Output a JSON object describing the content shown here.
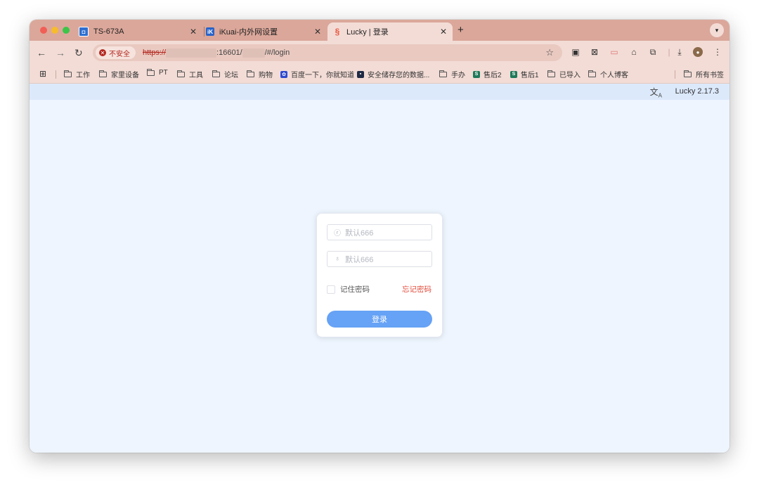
{
  "browser": {
    "tabs": [
      {
        "label": "TS-673A",
        "icon": "qnap-icon"
      },
      {
        "label": "iKuai-内外网设置",
        "icon": "ikuai-icon"
      },
      {
        "label": "Lucky | 登录",
        "icon": "lucky-icon",
        "active": true
      }
    ],
    "new_tab": "+",
    "address": {
      "security_label": "不安全",
      "scheme": "https://",
      "port_part": ":16601/",
      "path_part": "/#/login"
    },
    "bookmarks": [
      {
        "label": "工作",
        "type": "folder"
      },
      {
        "label": "家里设备",
        "type": "folder"
      },
      {
        "label": "PT",
        "type": "folder"
      },
      {
        "label": "工具",
        "type": "folder"
      },
      {
        "label": "论坛",
        "type": "folder"
      },
      {
        "label": "购物",
        "type": "folder"
      },
      {
        "label": "百度一下，你就知道",
        "type": "link"
      },
      {
        "label": "安全储存您的数据...",
        "type": "link"
      },
      {
        "label": "手办",
        "type": "folder"
      },
      {
        "label": "售后2",
        "type": "link"
      },
      {
        "label": "售后1",
        "type": "link"
      },
      {
        "label": "已导入",
        "type": "folder"
      },
      {
        "label": "个人博客",
        "type": "folder"
      }
    ],
    "all_bookmarks": "所有书签",
    "colors": {
      "tab_strip": "#dba79a",
      "toolbar": "#f3dcd6"
    }
  },
  "page": {
    "version": "Lucky 2.17.3",
    "translate_icon": "translate-icon",
    "login": {
      "username_placeholder": "默认666",
      "password_placeholder": "默认666",
      "remember_label": "记住密码",
      "forgot_label": "忘记密码",
      "submit_label": "登录"
    },
    "colors": {
      "primary": "#66a2f5",
      "danger": "#e34b3b",
      "background": "#eef5fe"
    }
  }
}
